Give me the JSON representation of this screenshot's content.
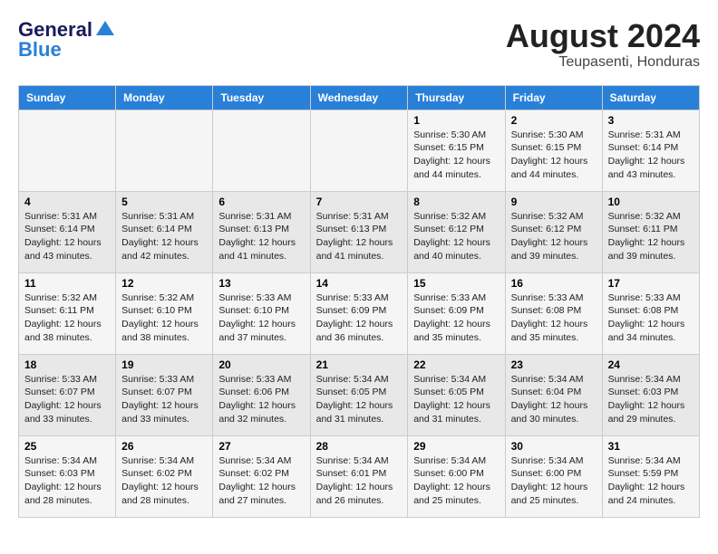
{
  "header": {
    "logo_general": "General",
    "logo_blue": "Blue",
    "month_year": "August 2024",
    "location": "Teupasenti, Honduras"
  },
  "days_of_week": [
    "Sunday",
    "Monday",
    "Tuesday",
    "Wednesday",
    "Thursday",
    "Friday",
    "Saturday"
  ],
  "weeks": [
    [
      {
        "day": "",
        "info": ""
      },
      {
        "day": "",
        "info": ""
      },
      {
        "day": "",
        "info": ""
      },
      {
        "day": "",
        "info": ""
      },
      {
        "day": "1",
        "info": "Sunrise: 5:30 AM\nSunset: 6:15 PM\nDaylight: 12 hours\nand 44 minutes."
      },
      {
        "day": "2",
        "info": "Sunrise: 5:30 AM\nSunset: 6:15 PM\nDaylight: 12 hours\nand 44 minutes."
      },
      {
        "day": "3",
        "info": "Sunrise: 5:31 AM\nSunset: 6:14 PM\nDaylight: 12 hours\nand 43 minutes."
      }
    ],
    [
      {
        "day": "4",
        "info": "Sunrise: 5:31 AM\nSunset: 6:14 PM\nDaylight: 12 hours\nand 43 minutes."
      },
      {
        "day": "5",
        "info": "Sunrise: 5:31 AM\nSunset: 6:14 PM\nDaylight: 12 hours\nand 42 minutes."
      },
      {
        "day": "6",
        "info": "Sunrise: 5:31 AM\nSunset: 6:13 PM\nDaylight: 12 hours\nand 41 minutes."
      },
      {
        "day": "7",
        "info": "Sunrise: 5:31 AM\nSunset: 6:13 PM\nDaylight: 12 hours\nand 41 minutes."
      },
      {
        "day": "8",
        "info": "Sunrise: 5:32 AM\nSunset: 6:12 PM\nDaylight: 12 hours\nand 40 minutes."
      },
      {
        "day": "9",
        "info": "Sunrise: 5:32 AM\nSunset: 6:12 PM\nDaylight: 12 hours\nand 39 minutes."
      },
      {
        "day": "10",
        "info": "Sunrise: 5:32 AM\nSunset: 6:11 PM\nDaylight: 12 hours\nand 39 minutes."
      }
    ],
    [
      {
        "day": "11",
        "info": "Sunrise: 5:32 AM\nSunset: 6:11 PM\nDaylight: 12 hours\nand 38 minutes."
      },
      {
        "day": "12",
        "info": "Sunrise: 5:32 AM\nSunset: 6:10 PM\nDaylight: 12 hours\nand 38 minutes."
      },
      {
        "day": "13",
        "info": "Sunrise: 5:33 AM\nSunset: 6:10 PM\nDaylight: 12 hours\nand 37 minutes."
      },
      {
        "day": "14",
        "info": "Sunrise: 5:33 AM\nSunset: 6:09 PM\nDaylight: 12 hours\nand 36 minutes."
      },
      {
        "day": "15",
        "info": "Sunrise: 5:33 AM\nSunset: 6:09 PM\nDaylight: 12 hours\nand 35 minutes."
      },
      {
        "day": "16",
        "info": "Sunrise: 5:33 AM\nSunset: 6:08 PM\nDaylight: 12 hours\nand 35 minutes."
      },
      {
        "day": "17",
        "info": "Sunrise: 5:33 AM\nSunset: 6:08 PM\nDaylight: 12 hours\nand 34 minutes."
      }
    ],
    [
      {
        "day": "18",
        "info": "Sunrise: 5:33 AM\nSunset: 6:07 PM\nDaylight: 12 hours\nand 33 minutes."
      },
      {
        "day": "19",
        "info": "Sunrise: 5:33 AM\nSunset: 6:07 PM\nDaylight: 12 hours\nand 33 minutes."
      },
      {
        "day": "20",
        "info": "Sunrise: 5:33 AM\nSunset: 6:06 PM\nDaylight: 12 hours\nand 32 minutes."
      },
      {
        "day": "21",
        "info": "Sunrise: 5:34 AM\nSunset: 6:05 PM\nDaylight: 12 hours\nand 31 minutes."
      },
      {
        "day": "22",
        "info": "Sunrise: 5:34 AM\nSunset: 6:05 PM\nDaylight: 12 hours\nand 31 minutes."
      },
      {
        "day": "23",
        "info": "Sunrise: 5:34 AM\nSunset: 6:04 PM\nDaylight: 12 hours\nand 30 minutes."
      },
      {
        "day": "24",
        "info": "Sunrise: 5:34 AM\nSunset: 6:03 PM\nDaylight: 12 hours\nand 29 minutes."
      }
    ],
    [
      {
        "day": "25",
        "info": "Sunrise: 5:34 AM\nSunset: 6:03 PM\nDaylight: 12 hours\nand 28 minutes."
      },
      {
        "day": "26",
        "info": "Sunrise: 5:34 AM\nSunset: 6:02 PM\nDaylight: 12 hours\nand 28 minutes."
      },
      {
        "day": "27",
        "info": "Sunrise: 5:34 AM\nSunset: 6:02 PM\nDaylight: 12 hours\nand 27 minutes."
      },
      {
        "day": "28",
        "info": "Sunrise: 5:34 AM\nSunset: 6:01 PM\nDaylight: 12 hours\nand 26 minutes."
      },
      {
        "day": "29",
        "info": "Sunrise: 5:34 AM\nSunset: 6:00 PM\nDaylight: 12 hours\nand 25 minutes."
      },
      {
        "day": "30",
        "info": "Sunrise: 5:34 AM\nSunset: 6:00 PM\nDaylight: 12 hours\nand 25 minutes."
      },
      {
        "day": "31",
        "info": "Sunrise: 5:34 AM\nSunset: 5:59 PM\nDaylight: 12 hours\nand 24 minutes."
      }
    ]
  ]
}
